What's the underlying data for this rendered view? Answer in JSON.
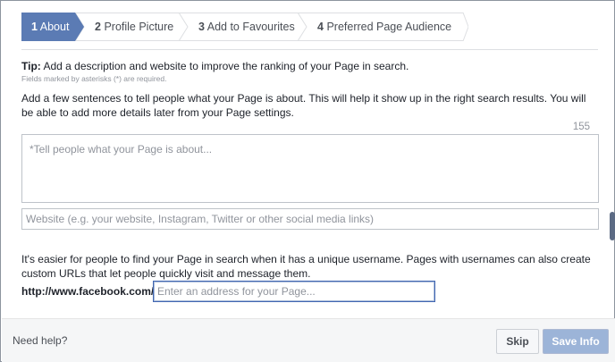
{
  "steps": [
    {
      "num": "1",
      "label": "About",
      "active": true
    },
    {
      "num": "2",
      "label": "Profile Picture",
      "active": false
    },
    {
      "num": "3",
      "label": "Add to Favourites",
      "active": false
    },
    {
      "num": "4",
      "label": "Preferred Page Audience",
      "active": false
    }
  ],
  "tip": {
    "prefix": "Tip:",
    "text": " Add a description and website to improve the ranking of your Page in search.",
    "required_note": "Fields marked by asterisks (*) are required."
  },
  "about": {
    "description": "Add a few sentences to tell people what your Page is about. This will help it show up in the right search results. You will be able to add more details later from your Page settings.",
    "char_counter": "155",
    "placeholder": "*Tell people what your Page is about..."
  },
  "website": {
    "placeholder": "Website (e.g. your website, Instagram, Twitter or other  social media links)"
  },
  "username": {
    "description": "It's easier for people to find your Page in search when it has a unique username. Pages with usernames can also create custom URLs that let people quickly visit and message them.",
    "url_prefix": "http://www.facebook.com/",
    "placeholder": "Enter an address for your Page..."
  },
  "footer": {
    "help": "Need help?",
    "skip_label": "Skip",
    "save_label": "Save Info"
  },
  "colors": {
    "active_step": "#5b7bb4",
    "save_button": "#9cb4d8",
    "focus_border": "#4267b2"
  }
}
